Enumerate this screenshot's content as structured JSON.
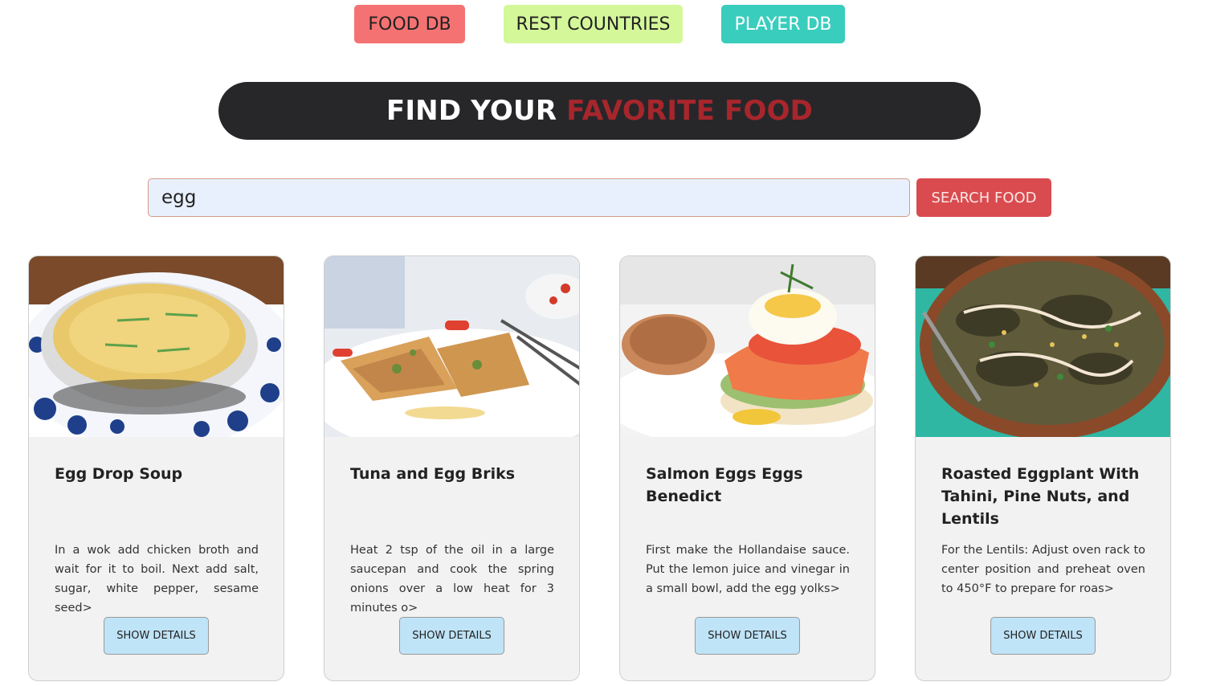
{
  "nav": {
    "food_db": "FOOD DB",
    "rest_countries": "REST COUNTRIES",
    "player_db": "PLAYER DB"
  },
  "banner": {
    "text_white": "FIND YOUR",
    "text_red": "FAVORITE FOOD"
  },
  "search": {
    "value": "egg",
    "button_label": "SEARCH FOOD"
  },
  "cards": [
    {
      "title": "Egg Drop Soup",
      "description": "In a wok add chicken broth and wait for it to boil. Next add salt, sugar, white pepper, sesame seed>",
      "button_label": "SHOW DETAILS",
      "image_icon": "egg-drop-soup-image"
    },
    {
      "title": "Tuna and Egg Briks",
      "description": "Heat 2 tsp of the oil in a large saucepan and cook the spring onions over a low heat for 3 minutes o>",
      "button_label": "SHOW DETAILS",
      "image_icon": "tuna-egg-briks-image"
    },
    {
      "title": "Salmon Eggs Eggs Benedict",
      "description": "First make the Hollandaise sauce. Put the lemon juice and vinegar in a small bowl, add the egg yolks>",
      "button_label": "SHOW DETAILS",
      "image_icon": "salmon-eggs-benedict-image"
    },
    {
      "title": "Roasted Eggplant With Tahini, Pine Nuts, and Lentils",
      "description": "For the Lentils: Adjust oven rack to center position and preheat oven to 450°F to prepare for roas>",
      "button_label": "SHOW DETAILS",
      "image_icon": "roasted-eggplant-image"
    }
  ],
  "colors": {
    "nav_food": "#f57272",
    "nav_rest": "#d4f79a",
    "nav_player": "#39cdbd",
    "banner_bg": "#27272a",
    "banner_accent": "#a7262c",
    "search_button": "#d94b4f",
    "details_button": "#bfe3f7"
  }
}
